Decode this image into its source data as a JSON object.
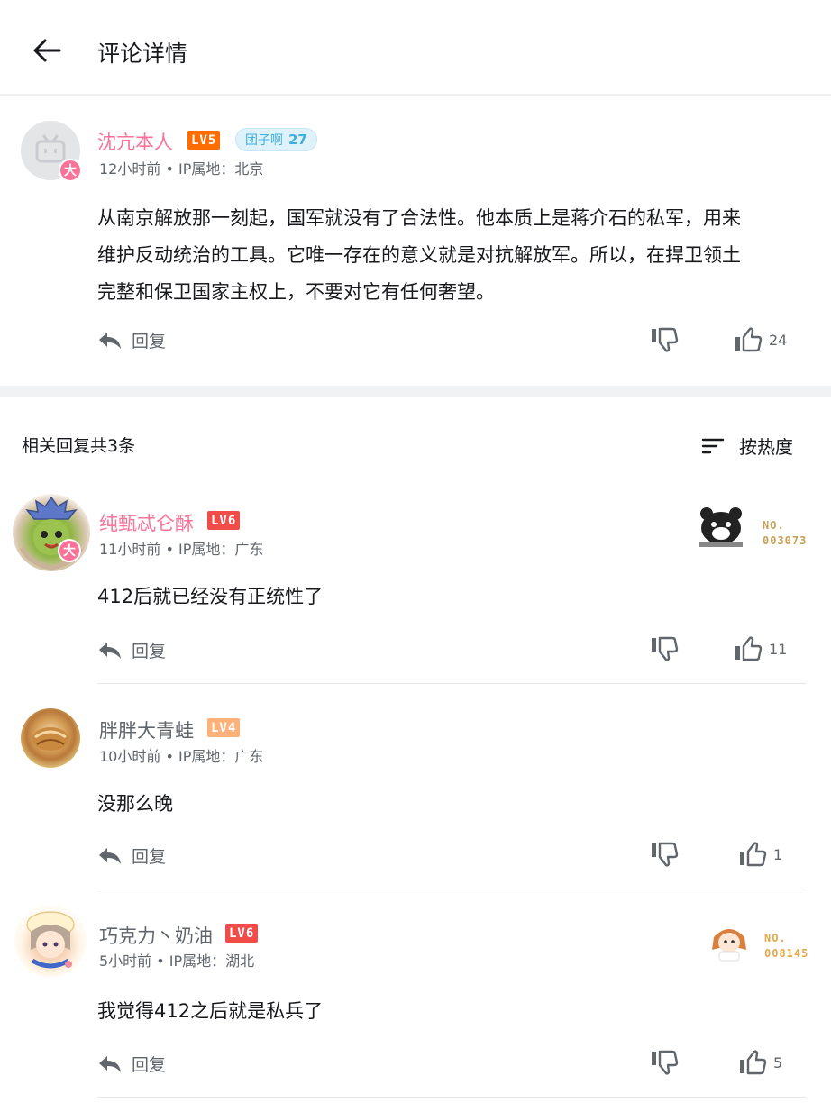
{
  "header": {
    "title": "评论详情"
  },
  "main_comment": {
    "username": "沈亢本人",
    "level": "LV5",
    "fan_badge": {
      "name": "团子啊",
      "level": "27"
    },
    "vip_mark": "大",
    "meta": "12小时前 • IP属地：北京",
    "content_lines": [
      "从南京解放那一刻起，国军就没有了合法性。他本质上是蒋介石的私军，用来",
      "维护反动统治的工具。它唯一存在的意义就是对抗解放军。所以，在捍卫领土",
      "完整和保卫国家主权上，不要对它有任何奢望。"
    ],
    "reply_label": "回复",
    "likes": "24"
  },
  "replies_section": {
    "title": "相关回复共3条",
    "sort_label": "按热度"
  },
  "replies": [
    {
      "username": "纯甄忒仑酥",
      "level": "LV6",
      "vip_mark": "大",
      "meta": "11小时前 • IP属地：广东",
      "content": "412后就已经没有正统性了",
      "reply_label": "回复",
      "likes": "11",
      "collect_badge": {
        "line1": "NO.",
        "line2": "003073"
      }
    },
    {
      "username": "胖胖大青蛙",
      "level": "LV4",
      "meta": "10小时前 • IP属地：广东",
      "content": "没那么晚",
      "reply_label": "回复",
      "likes": "1"
    },
    {
      "username": "巧克力丶奶油",
      "level": "LV6",
      "meta": "5小时前 • IP属地：湖北",
      "content": "我觉得412之后就是私兵了",
      "reply_label": "回复",
      "likes": "5",
      "collect_badge": {
        "line1": "NO.",
        "line2": "008145"
      }
    }
  ],
  "colors": {
    "accent_pink": "#fb7299",
    "lv5": "#ff6c00",
    "lv6": "#f04c49",
    "lv4": "#feb27a",
    "fan_badge_text": "#3eb0de",
    "badge_gold": "#e3a84a"
  },
  "icons": {
    "back": "arrow-left-icon",
    "reply": "reply-arrow-icon",
    "dislike": "thumbs-down-icon",
    "like": "thumbs-up-icon",
    "sort": "sort-lines-icon"
  }
}
